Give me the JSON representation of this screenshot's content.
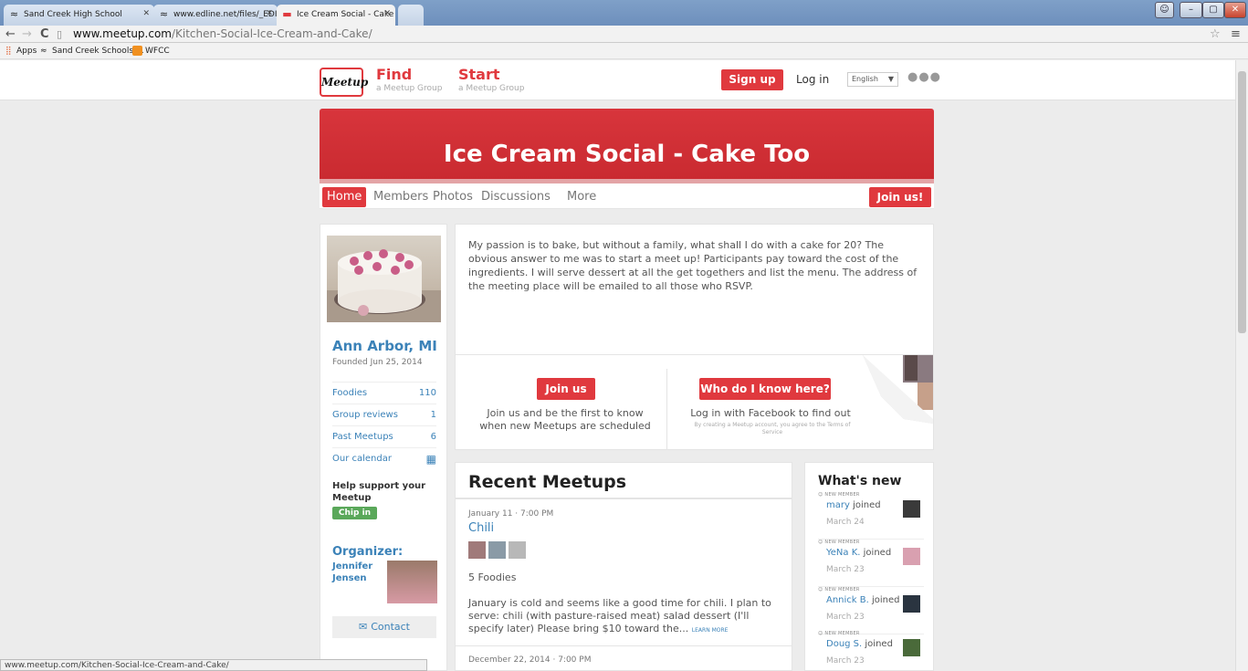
{
  "browser": {
    "tabs": [
      {
        "label": "Sand Creek High School"
      },
      {
        "label": "www.edline.net/files/_EDI"
      },
      {
        "label": "Ice Cream Social - Cake T"
      }
    ],
    "url_host": "www.meetup.com",
    "url_path": "/Kitchen-Social-Ice-Cream-and-Cake/",
    "bookmarks": [
      "Apps",
      "Sand Creek Schools:...",
      "WFCC"
    ],
    "status_url": "www.meetup.com/Kitchen-Social-Ice-Cream-and-Cake/"
  },
  "header": {
    "logo": "Meetup",
    "find": "Find",
    "find_sub": "a Meetup Group",
    "start": "Start",
    "start_sub": "a Meetup Group",
    "signup": "Sign up",
    "login": "Log in",
    "language": "English"
  },
  "group": {
    "name": "Ice Cream Social - Cake Too",
    "tabs": [
      "Home",
      "Members",
      "Photos",
      "Discussions",
      "More"
    ],
    "join_top": "Join us!",
    "city": "Ann Arbor, MI",
    "founded": "Founded Jun 25, 2014",
    "stats": [
      {
        "label": "Foodies",
        "value": "110"
      },
      {
        "label": "Group reviews",
        "value": "1"
      },
      {
        "label": "Past Meetups",
        "value": "6"
      },
      {
        "label": "Our calendar",
        "value": ""
      }
    ],
    "support": "Help support your Meetup",
    "chip_in": "Chip in",
    "organizer_label": "Organizer:",
    "organizer_name": "Jennifer Jensen",
    "contact": "Contact"
  },
  "description": {
    "text": "My passion is to bake, but without a family, what shall I do with a cake for 20? The obvious answer to me was to start a meet up! Participants pay toward the cost of the ingredients. I will serve dessert at all the get togethers and list the menu. The address of the meeting place will be emailed to all those who RSVP.",
    "join_btn": "Join us",
    "join_text": "Join us and be the first to know when new Meetups are scheduled",
    "who_btn": "Who do I know here?",
    "fb_text": "Log in with Facebook to find out",
    "terms": "By creating a Meetup account, you agree to the Terms of Service"
  },
  "recent": {
    "title": "Recent Meetups",
    "events": [
      {
        "date": "January 11 · 7:00 PM",
        "title": "Chili",
        "count": "5 Foodies",
        "desc": "January is cold and seems like a good time for chili. I plan to serve: chili (with pasture-raised meat) salad dessert (I'll specify later) Please bring $10 toward the...",
        "learn_more": "LEARN MORE"
      },
      {
        "date": "December 22, 2014 · 7:00 PM"
      }
    ]
  },
  "whats_new": {
    "title": "What's new",
    "tag": "NEW MEMBER",
    "items": [
      {
        "name": "mary",
        "action": "joined",
        "date": "March 24"
      },
      {
        "name": "YeNa K.",
        "action": "joined",
        "date": "March 23"
      },
      {
        "name": "Annick B.",
        "action": "joined",
        "date": "March 23"
      },
      {
        "name": "Doug S.",
        "action": "joined",
        "date": "March 23"
      }
    ]
  },
  "colors": {
    "brand": "#e0393e",
    "link": "#3b82b8",
    "chip": "#5aa85a"
  }
}
